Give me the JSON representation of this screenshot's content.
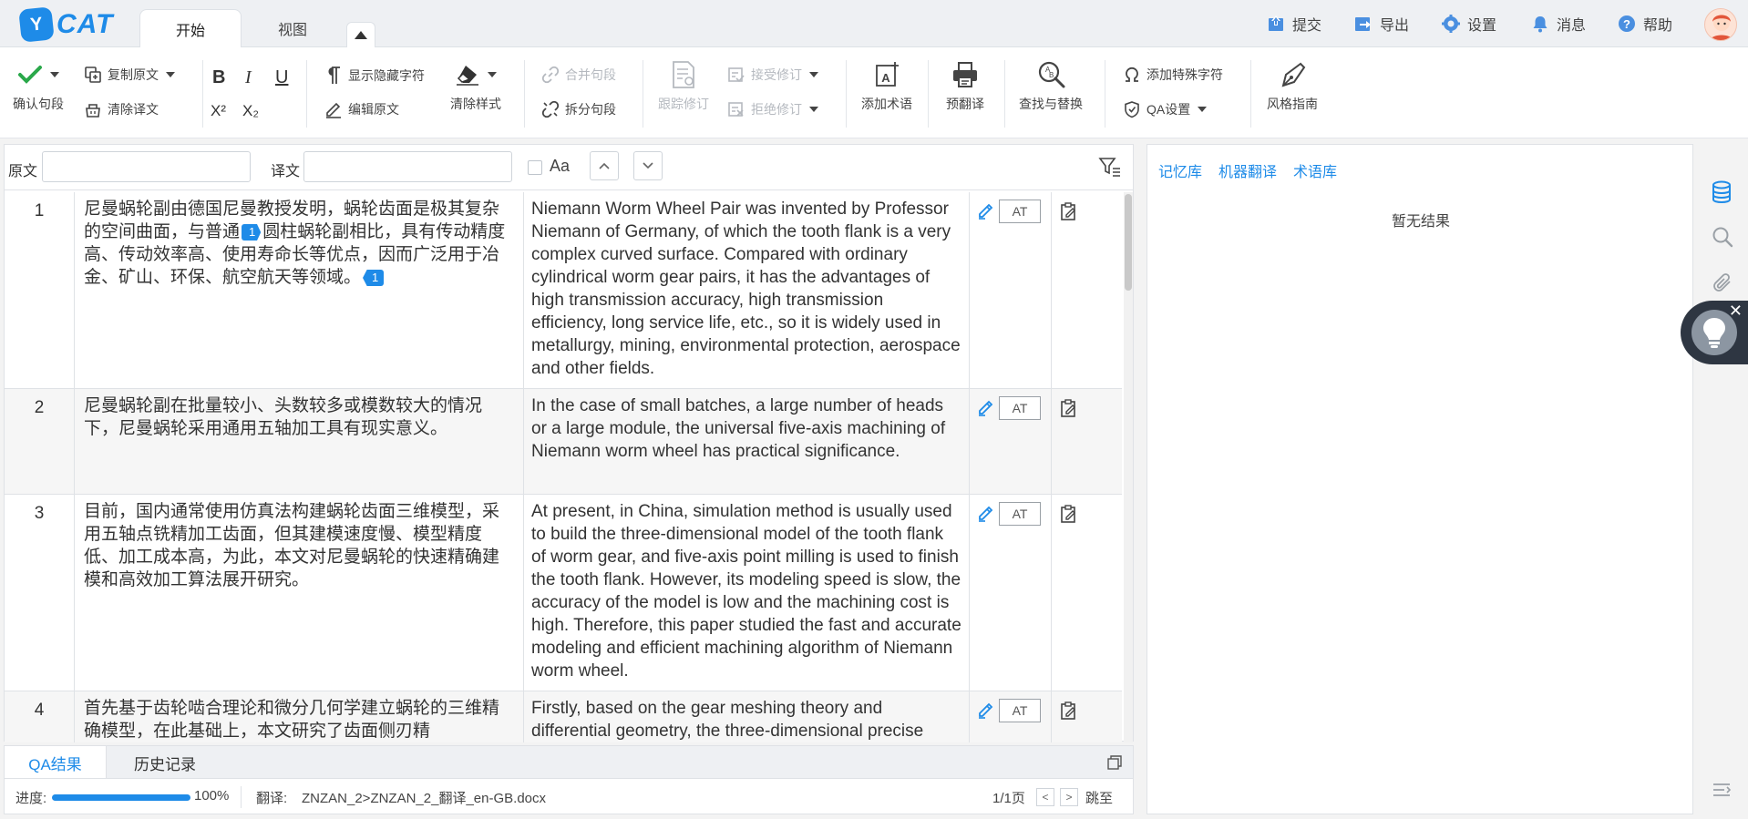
{
  "app": {
    "logo_badge": "Y",
    "logo_text": "CAT"
  },
  "tabs": [
    {
      "label": "开始",
      "active": true
    },
    {
      "label": "视图",
      "active": false
    }
  ],
  "topnav": [
    {
      "label": "提交",
      "icon": "upload-icon"
    },
    {
      "label": "导出",
      "icon": "export-icon"
    },
    {
      "label": "设置",
      "icon": "gear-icon"
    },
    {
      "label": "消息",
      "icon": "bell-icon"
    },
    {
      "label": "帮助",
      "icon": "help-icon"
    }
  ],
  "ribbon": {
    "confirm": "确认句段",
    "copy_source": "复制原文",
    "clear_target": "清除译文",
    "bold": "B",
    "italic": "I",
    "underline": "U",
    "superscript": "X²",
    "subscript": "X₂",
    "show_hidden": "显示隐藏字符",
    "edit_source": "编辑原文",
    "clear_format": "清除样式",
    "merge": "合并句段",
    "split": "拆分句段",
    "track": "跟踪修订",
    "accept": "接受修订",
    "reject": "拒绝修订",
    "add_term": "添加术语",
    "pretranslate": "预翻译",
    "find_replace": "查找与替换",
    "special_char": "添加特殊字符",
    "qa_settings": "QA设置",
    "style_guide": "风格指南"
  },
  "filter": {
    "source_label": "原文",
    "source_value": "",
    "source_placeholder": "",
    "target_label": "译文",
    "target_value": "",
    "target_placeholder": "",
    "case_label": "Aa"
  },
  "segments": [
    {
      "num": "1",
      "source_parts": [
        "尼曼蜗轮副由德国尼曼教授发明，蜗轮齿面是极其复杂的空间曲面，与普通",
        "圆柱蜗轮副相比，具有传动精度高、传动效率高、使用寿命长等优点，因而广泛用于冶金、矿山、环保、航空航天等领域。"
      ],
      "tag_open": "1",
      "tag_close": "1",
      "target": "Niemann Worm Wheel Pair was invented by Professor Niemann of Germany, of which the tooth flank is a very complex curved surface. Compared with ordinary cylindrical worm gear pairs, it has the advantages of high transmission accuracy, high transmission efficiency, long service life, etc., so it is widely used in metallurgy, mining, environmental protection, aerospace and other fields.",
      "status": "AT"
    },
    {
      "num": "2",
      "source": "尼曼蜗轮副在批量较小、头数较多或模数较大的情况下，尼曼蜗轮采用通用五轴加工具有现实意义。",
      "target": "In the case of small batches, a large number of heads or a large module, the universal five-axis machining of Niemann worm wheel has practical significance.",
      "status": "AT"
    },
    {
      "num": "3",
      "source": "目前，国内通常使用仿真法构建蜗轮齿面三维模型，采用五轴点铣精加工齿面，但其建模速度慢、模型精度低、加工成本高，为此，本文对尼曼蜗轮的快速精确建模和高效加工算法展开研究。",
      "target": "At present, in China, simulation method is usually used to build the three-dimensional model of the tooth flank of worm gear, and five-axis point milling is used to finish the tooth flank. However, its modeling speed is slow, the accuracy of the model is low and the machining cost is high. Therefore, this paper studied the fast and accurate modeling and efficient machining algorithm of Niemann worm wheel.",
      "status": "AT"
    },
    {
      "num": "4",
      "source": "首先基于齿轮啮合理论和微分几何学建立蜗轮的三维精确模型，在此基础上，本文研究了齿面侧刃精",
      "target": "Firstly, based on the gear meshing theory and differential geometry, the three-dimensional precise",
      "status": "AT"
    }
  ],
  "bottom_tabs": [
    {
      "label": "QA结果",
      "active": true
    },
    {
      "label": "历史记录",
      "active": false
    }
  ],
  "status": {
    "progress_label": "进度:",
    "progress_value": 1.0,
    "progress_text": "100%",
    "file_label": "翻译:",
    "file_name": "ZNZAN_2>ZNZAN_2_翻译_en-GB.docx",
    "page_text": "1/1页",
    "prev": "<",
    "next": ">",
    "jump": "跳至"
  },
  "right_panel": {
    "tabs": [
      "记忆库",
      "机器翻译",
      "术语库"
    ],
    "empty_text": "暂无结果",
    "close_symbol": "✕"
  },
  "colors": {
    "accent": "#1e8be8",
    "disabled": "#b5b9bf",
    "check": "#2aa84a"
  }
}
